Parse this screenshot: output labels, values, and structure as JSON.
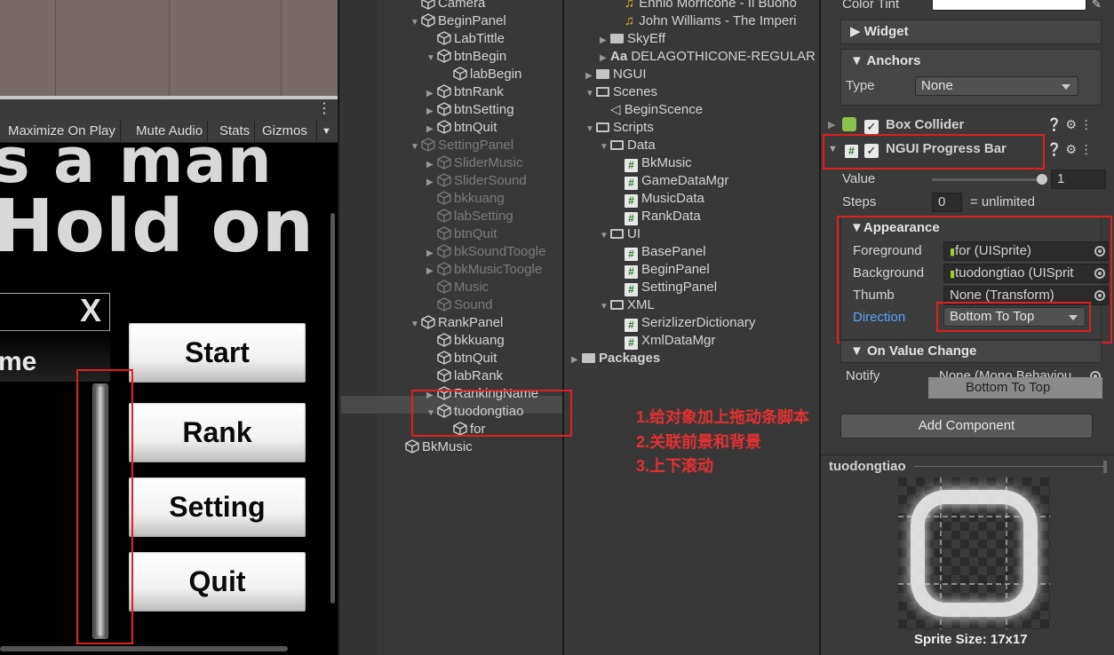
{
  "game_view": {
    "toolbar": [
      "Maximize On Play",
      "Mute Audio",
      "Stats",
      "Gizmos"
    ],
    "kebab": "⋮",
    "dropdown_arrow": "▼",
    "line1": "s a man",
    "line2": "Hold on",
    "rank_close": "X",
    "rank_title": "me",
    "buttons": [
      "Start",
      "Rank",
      "Setting",
      "Quit"
    ]
  },
  "hierarchy": {
    "items": [
      {
        "label": "Camera",
        "dim": false
      },
      {
        "label": "BeginPanel",
        "dim": false
      },
      {
        "label": "LabTittle",
        "dim": false
      },
      {
        "label": "btnBegin",
        "dim": false
      },
      {
        "label": "labBegin",
        "dim": false
      },
      {
        "label": "btnRank",
        "dim": false
      },
      {
        "label": "btnSetting",
        "dim": false
      },
      {
        "label": "btnQuit",
        "dim": false
      },
      {
        "label": "SettingPanel",
        "dim": true
      },
      {
        "label": "SliderMusic",
        "dim": true
      },
      {
        "label": "SliderSound",
        "dim": true
      },
      {
        "label": "bkkuang",
        "dim": true
      },
      {
        "label": "labSetting",
        "dim": true
      },
      {
        "label": "btnQuit",
        "dim": true
      },
      {
        "label": "bkSoundToogle",
        "dim": true
      },
      {
        "label": "bkMusicToogle",
        "dim": true
      },
      {
        "label": "Music",
        "dim": true
      },
      {
        "label": "Sound",
        "dim": true
      },
      {
        "label": "RankPanel",
        "dim": false
      },
      {
        "label": "bkkuang",
        "dim": false
      },
      {
        "label": "btnQuit",
        "dim": false
      },
      {
        "label": "labRank",
        "dim": false
      },
      {
        "label": "RankingName",
        "dim": false
      },
      {
        "label": "tuodongtiao",
        "dim": false
      },
      {
        "label": "for",
        "dim": false
      },
      {
        "label": "BkMusic",
        "dim": false
      }
    ]
  },
  "project": {
    "items": [
      {
        "label": "Ennio Morricone - Il Buono",
        "icon": "music-icon"
      },
      {
        "label": "John Williams - The Imperi",
        "icon": "music-icon"
      },
      {
        "label": "SkyEff",
        "icon": "folder-icon"
      },
      {
        "label": "DELAGOTHICONE-REGULAR",
        "icon": "font-icon",
        "prefix": "Aa"
      },
      {
        "label": "NGUI",
        "icon": "folder-icon"
      },
      {
        "label": "Scenes",
        "icon": "folder-open-icon"
      },
      {
        "label": "BeginScence",
        "icon": "unity-scene-icon"
      },
      {
        "label": "Scripts",
        "icon": "folder-open-icon"
      },
      {
        "label": "Data",
        "icon": "folder-open-icon"
      },
      {
        "label": "BkMusic",
        "icon": "script-icon"
      },
      {
        "label": "GameDataMgr",
        "icon": "script-icon"
      },
      {
        "label": "MusicData",
        "icon": "script-icon"
      },
      {
        "label": "RankData",
        "icon": "script-icon"
      },
      {
        "label": "UI",
        "icon": "folder-open-icon"
      },
      {
        "label": "BasePanel",
        "icon": "script-icon"
      },
      {
        "label": "BeginPanel",
        "icon": "script-icon"
      },
      {
        "label": "SettingPanel",
        "icon": "script-icon"
      },
      {
        "label": "XML",
        "icon": "folder-open-icon"
      },
      {
        "label": "SerizlizerDictionary",
        "icon": "script-icon"
      },
      {
        "label": "XmlDataMgr",
        "icon": "script-icon"
      },
      {
        "label": "Packages",
        "icon": "folder-icon"
      }
    ],
    "hash_glyph": "#"
  },
  "annotations": {
    "lines": [
      "1.给对象加上拖动条脚本",
      "2.关联前景和背景",
      "3.上下滚动"
    ]
  },
  "inspector": {
    "color_tint_label": "Color Tint",
    "widget_label": "Widget",
    "anchors_label": "Anchors",
    "type_label": "Type",
    "type_value": "None",
    "box_collider_label": "Box Collider",
    "progress_bar_label": "NGUI Progress Bar",
    "value_label": "Value",
    "value_value": "1",
    "steps_label": "Steps",
    "steps_value": "0",
    "steps_suffix": "= unlimited",
    "appearance_label": "Appearance",
    "foreground_label": "Foreground",
    "foreground_value": "for (UISprite)",
    "background_label": "Background",
    "background_value": "tuodongtiao (UISprit",
    "thumb_label": "Thumb",
    "thumb_value": "None (Transform)",
    "direction_label": "Direction",
    "direction_value": "Bottom To Top",
    "on_value_change_label": "On Value Change",
    "notify_label": "Notify",
    "notify_value": "None (Mono Behaviou",
    "tooltip": "Bottom To Top",
    "add_component": "Add Component",
    "preview_title": "tuodongtiao",
    "sprite_size": "Sprite Size: 17x17",
    "value_progress": 1.0
  },
  "colors": {
    "accent_red": "#e02020",
    "link_blue": "#58a6ff"
  }
}
